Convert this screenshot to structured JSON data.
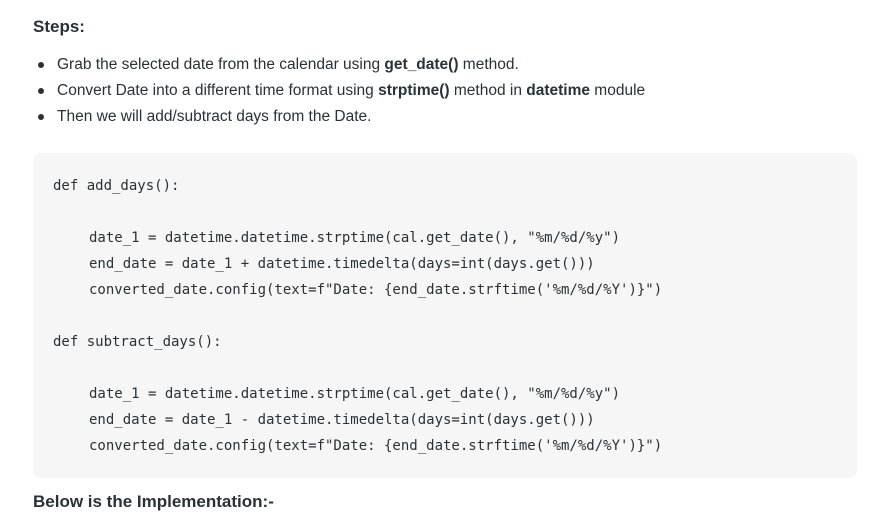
{
  "steps": {
    "heading": "Steps:",
    "items": [
      {
        "pre": "Grab the selected date from the calendar using ",
        "strong1": "get_date()",
        "mid": " method.",
        "strong2": "",
        "post": ""
      },
      {
        "pre": "Convert Date into a different time format using ",
        "strong1": "strptime()",
        "mid": " method in ",
        "strong2": "datetime",
        "post": " module"
      },
      {
        "pre": "Then we will add/subtract days from the Date.",
        "strong1": "",
        "mid": "",
        "strong2": "",
        "post": ""
      }
    ]
  },
  "code": {
    "lines": [
      "def add_days():",
      "date_1 = datetime.datetime.strptime(cal.get_date(), \"%m/%d/%y\")",
      "end_date = date_1 + datetime.timedelta(days=int(days.get()))",
      "converted_date.config(text=f\"Date: {end_date.strftime('%m/%d/%Y')}\")",
      "def subtract_days():",
      "date_1 = datetime.datetime.strptime(cal.get_date(), \"%m/%d/%y\")",
      "end_date = date_1 - datetime.timedelta(days=int(days.get()))",
      "converted_date.config(text=f\"Date: {end_date.strftime('%m/%d/%Y')}\")"
    ]
  },
  "footer": {
    "heading": "Below is the Implementation:-"
  }
}
